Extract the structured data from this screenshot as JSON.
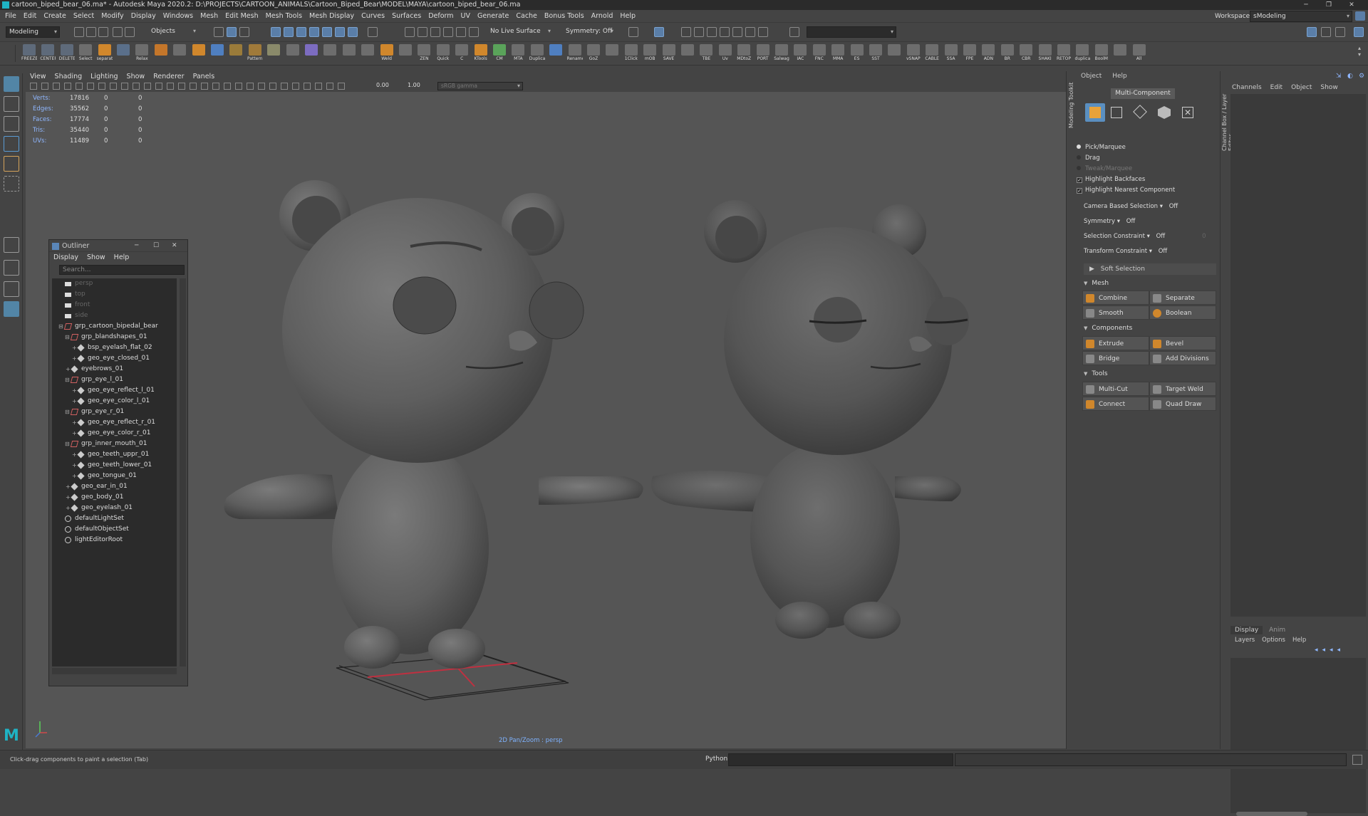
{
  "window": {
    "title": "cartoon_biped_bear_06.ma* - Autodesk Maya 2020.2: D:\\PROJECTS\\CARTOON_ANIMALS\\Cartoon_Biped_Bear\\MODEL\\MAYA\\cartoon_biped_bear_06.ma"
  },
  "menubar": [
    "File",
    "Edit",
    "Create",
    "Select",
    "Modify",
    "Display",
    "Windows",
    "Mesh",
    "Edit Mesh",
    "Mesh Tools",
    "Mesh Display",
    "Curves",
    "Surfaces",
    "Deform",
    "UV",
    "Generate",
    "Cache",
    "Bonus Tools",
    "Arnold",
    "Help"
  ],
  "workspace": {
    "label": "Workspace :",
    "value": "sModeling"
  },
  "statusline": {
    "menuset": "Modeling",
    "objects": "Objects",
    "live_surface": "No Live Surface",
    "symmetry": "Symmetry: Off"
  },
  "shelf": [
    {
      "label": "FREEZE",
      "color": "#5e6a7a"
    },
    {
      "label": "CENTER",
      "color": "#5e6a7a"
    },
    {
      "label": "DELETE",
      "color": "#5e6a7a"
    },
    {
      "label": "Select",
      "color": "#6d6d6d"
    },
    {
      "label": "separat",
      "color": "#d0872c"
    },
    {
      "label": "",
      "color": "#5a6f8a"
    },
    {
      "label": "Relax",
      "color": "#6d6d6d"
    },
    {
      "label": "",
      "color": "#c4762a"
    },
    {
      "label": "",
      "color": "#6d6d6d"
    },
    {
      "label": "",
      "color": "#d0872c"
    },
    {
      "label": "",
      "color": "#4f7fc0"
    },
    {
      "label": "",
      "color": "#9a7b3a"
    },
    {
      "label": "Pattern",
      "color": "#a07a3a"
    },
    {
      "label": "",
      "color": "#8a8a6a"
    },
    {
      "label": "",
      "color": "#6d6d6d"
    },
    {
      "label": "",
      "color": "#7c6cc0"
    },
    {
      "label": "",
      "color": "#6d6d6d"
    },
    {
      "label": "",
      "color": "#6d6d6d"
    },
    {
      "label": "",
      "color": "#6d6d6d"
    },
    {
      "label": "Weld",
      "color": "#d0872c"
    },
    {
      "label": "",
      "color": "#6d6d6d"
    },
    {
      "label": "ZEN",
      "color": "#6d6d6d"
    },
    {
      "label": "Quick",
      "color": "#6d6d6d"
    },
    {
      "label": "C",
      "color": "#6d6d6d"
    },
    {
      "label": "KTools",
      "color": "#d0872c"
    },
    {
      "label": "CM",
      "color": "#5aa35a"
    },
    {
      "label": "MTA",
      "color": "#6d6d6d"
    },
    {
      "label": "Duplica",
      "color": "#6d6d6d"
    },
    {
      "label": "",
      "color": "#4f7fc0"
    },
    {
      "label": "Rename",
      "color": "#6d6d6d"
    },
    {
      "label": "GoZ",
      "color": "#6d6d6d"
    },
    {
      "label": "",
      "color": "#6d6d6d"
    },
    {
      "label": "1Click",
      "color": "#6d6d6d"
    },
    {
      "label": "mOB",
      "color": "#6d6d6d"
    },
    {
      "label": "SAVE",
      "color": "#6d6d6d"
    },
    {
      "label": "",
      "color": "#6d6d6d"
    },
    {
      "label": "TBE",
      "color": "#6d6d6d"
    },
    {
      "label": "Uv",
      "color": "#6d6d6d"
    },
    {
      "label": "MDtoZ",
      "color": "#6d6d6d"
    },
    {
      "label": "PORT",
      "color": "#6d6d6d"
    },
    {
      "label": "Salwag",
      "color": "#6d6d6d"
    },
    {
      "label": "IAC",
      "color": "#6d6d6d"
    },
    {
      "label": "FNC",
      "color": "#6d6d6d"
    },
    {
      "label": "MMA",
      "color": "#6d6d6d"
    },
    {
      "label": "ES",
      "color": "#6d6d6d"
    },
    {
      "label": "SST",
      "color": "#6d6d6d"
    },
    {
      "label": "",
      "color": "#6d6d6d"
    },
    {
      "label": "vSNAP",
      "color": "#6d6d6d"
    },
    {
      "label": "CABLE",
      "color": "#6d6d6d"
    },
    {
      "label": "SSA",
      "color": "#6d6d6d"
    },
    {
      "label": "FPE",
      "color": "#6d6d6d"
    },
    {
      "label": "ADN",
      "color": "#6d6d6d"
    },
    {
      "label": "BR",
      "color": "#6d6d6d"
    },
    {
      "label": "CBR",
      "color": "#6d6d6d"
    },
    {
      "label": "SHAKI",
      "color": "#6d6d6d"
    },
    {
      "label": "RETOP",
      "color": "#6d6d6d"
    },
    {
      "label": "duplica",
      "color": "#6d6d6d"
    },
    {
      "label": "BoolM",
      "color": "#6d6d6d"
    },
    {
      "label": "",
      "color": "#6d6d6d"
    },
    {
      "label": "All",
      "color": "#6d6d6d"
    }
  ],
  "viewport": {
    "menu": [
      "View",
      "Shading",
      "Lighting",
      "Show",
      "Renderer",
      "Panels"
    ],
    "field1": "0.00",
    "field2": "1.00",
    "colorspace": "sRGB gamma",
    "hud": [
      {
        "k": "Verts:",
        "v": "17816",
        "a": "0",
        "b": "0"
      },
      {
        "k": "Edges:",
        "v": "35562",
        "a": "0",
        "b": "0"
      },
      {
        "k": "Faces:",
        "v": "17774",
        "a": "0",
        "b": "0"
      },
      {
        "k": "Tris:",
        "v": "35440",
        "a": "0",
        "b": "0"
      },
      {
        "k": "UVs:",
        "v": "11489",
        "a": "0",
        "b": "0"
      }
    ],
    "camera_label": "2D Pan/Zoom : persp"
  },
  "outliner": {
    "title": "Outliner",
    "menu": [
      "Display",
      "Show",
      "Help"
    ],
    "search_placeholder": "Search...",
    "items": [
      {
        "label": "persp",
        "depth": 0,
        "type": "cam",
        "dim": true
      },
      {
        "label": "top",
        "depth": 0,
        "type": "cam",
        "dim": true
      },
      {
        "label": "front",
        "depth": 0,
        "type": "cam",
        "dim": true
      },
      {
        "label": "side",
        "depth": 0,
        "type": "cam",
        "dim": true
      },
      {
        "label": "grp_cartoon_bipedal_bear",
        "depth": 0,
        "type": "grp"
      },
      {
        "label": "grp_blandshapes_01",
        "depth": 1,
        "type": "grp"
      },
      {
        "label": "bsp_eyelash_flat_02",
        "depth": 2,
        "type": "mesh"
      },
      {
        "label": "geo_eye_closed_01",
        "depth": 2,
        "type": "mesh"
      },
      {
        "label": "eyebrows_01",
        "depth": 1,
        "type": "mesh"
      },
      {
        "label": "grp_eye_l_01",
        "depth": 1,
        "type": "grp"
      },
      {
        "label": "geo_eye_reflect_l_01",
        "depth": 2,
        "type": "mesh"
      },
      {
        "label": "geo_eye_color_l_01",
        "depth": 2,
        "type": "mesh"
      },
      {
        "label": "grp_eye_r_01",
        "depth": 1,
        "type": "grp"
      },
      {
        "label": "geo_eye_reflect_r_01",
        "depth": 2,
        "type": "mesh"
      },
      {
        "label": "geo_eye_color_r_01",
        "depth": 2,
        "type": "mesh"
      },
      {
        "label": "grp_inner_mouth_01",
        "depth": 1,
        "type": "grp"
      },
      {
        "label": "geo_teeth_uppr_01",
        "depth": 2,
        "type": "mesh"
      },
      {
        "label": "geo_teeth_lower_01",
        "depth": 2,
        "type": "mesh"
      },
      {
        "label": "geo_tongue_01",
        "depth": 2,
        "type": "mesh"
      },
      {
        "label": "geo_ear_in_01",
        "depth": 1,
        "type": "mesh"
      },
      {
        "label": "geo_body_01",
        "depth": 1,
        "type": "mesh"
      },
      {
        "label": "geo_eyelash_01",
        "depth": 1,
        "type": "mesh"
      },
      {
        "label": "defaultLightSet",
        "depth": 0,
        "type": "set"
      },
      {
        "label": "defaultObjectSet",
        "depth": 0,
        "type": "set"
      },
      {
        "label": "lightEditorRoot",
        "depth": 0,
        "type": "set"
      }
    ]
  },
  "modeling_toolkit": {
    "tab_label": "Modeling Toolkit",
    "menu": [
      "Object",
      "Help"
    ],
    "mode": "Multi-Component",
    "pick_marquee": "Pick/Marquee",
    "drag": "Drag",
    "tweak_marquee": "Tweak/Marquee",
    "highlight_backfaces": "Highlight Backfaces",
    "highlight_nearest": "Highlight Nearest Component",
    "camera_based_selection": {
      "label": "Camera Based Selection",
      "value": "Off"
    },
    "symmetry": {
      "label": "Symmetry",
      "value": "Off"
    },
    "selection_constraint": {
      "label": "Selection Constraint",
      "value": "Off",
      "extra": "0"
    },
    "transform_constraint": {
      "label": "Transform Constraint",
      "value": "Off"
    },
    "soft_selection": "Soft Selection",
    "sections": {
      "mesh": "Mesh",
      "components": "Components",
      "tools": "Tools"
    },
    "buttons": {
      "combine": "Combine",
      "separate": "Separate",
      "smooth": "Smooth",
      "boolean": "Boolean",
      "extrude": "Extrude",
      "bevel": "Bevel",
      "bridge": "Bridge",
      "add_divisions": "Add Divisions",
      "multi_cut": "Multi-Cut",
      "target_weld": "Target Weld",
      "connect": "Connect",
      "quad_draw": "Quad Draw"
    }
  },
  "channel_box": {
    "tab_label": "Channel Box / Layer Editor",
    "menu": [
      "Channels",
      "Edit",
      "Object",
      "Show"
    ],
    "layer_tabs": [
      "Display",
      "Anim"
    ],
    "layer_menu": [
      "Layers",
      "Options",
      "Help"
    ]
  },
  "command": {
    "help_text": "Click-drag components to paint a selection (Tab)",
    "lang": "Python"
  }
}
